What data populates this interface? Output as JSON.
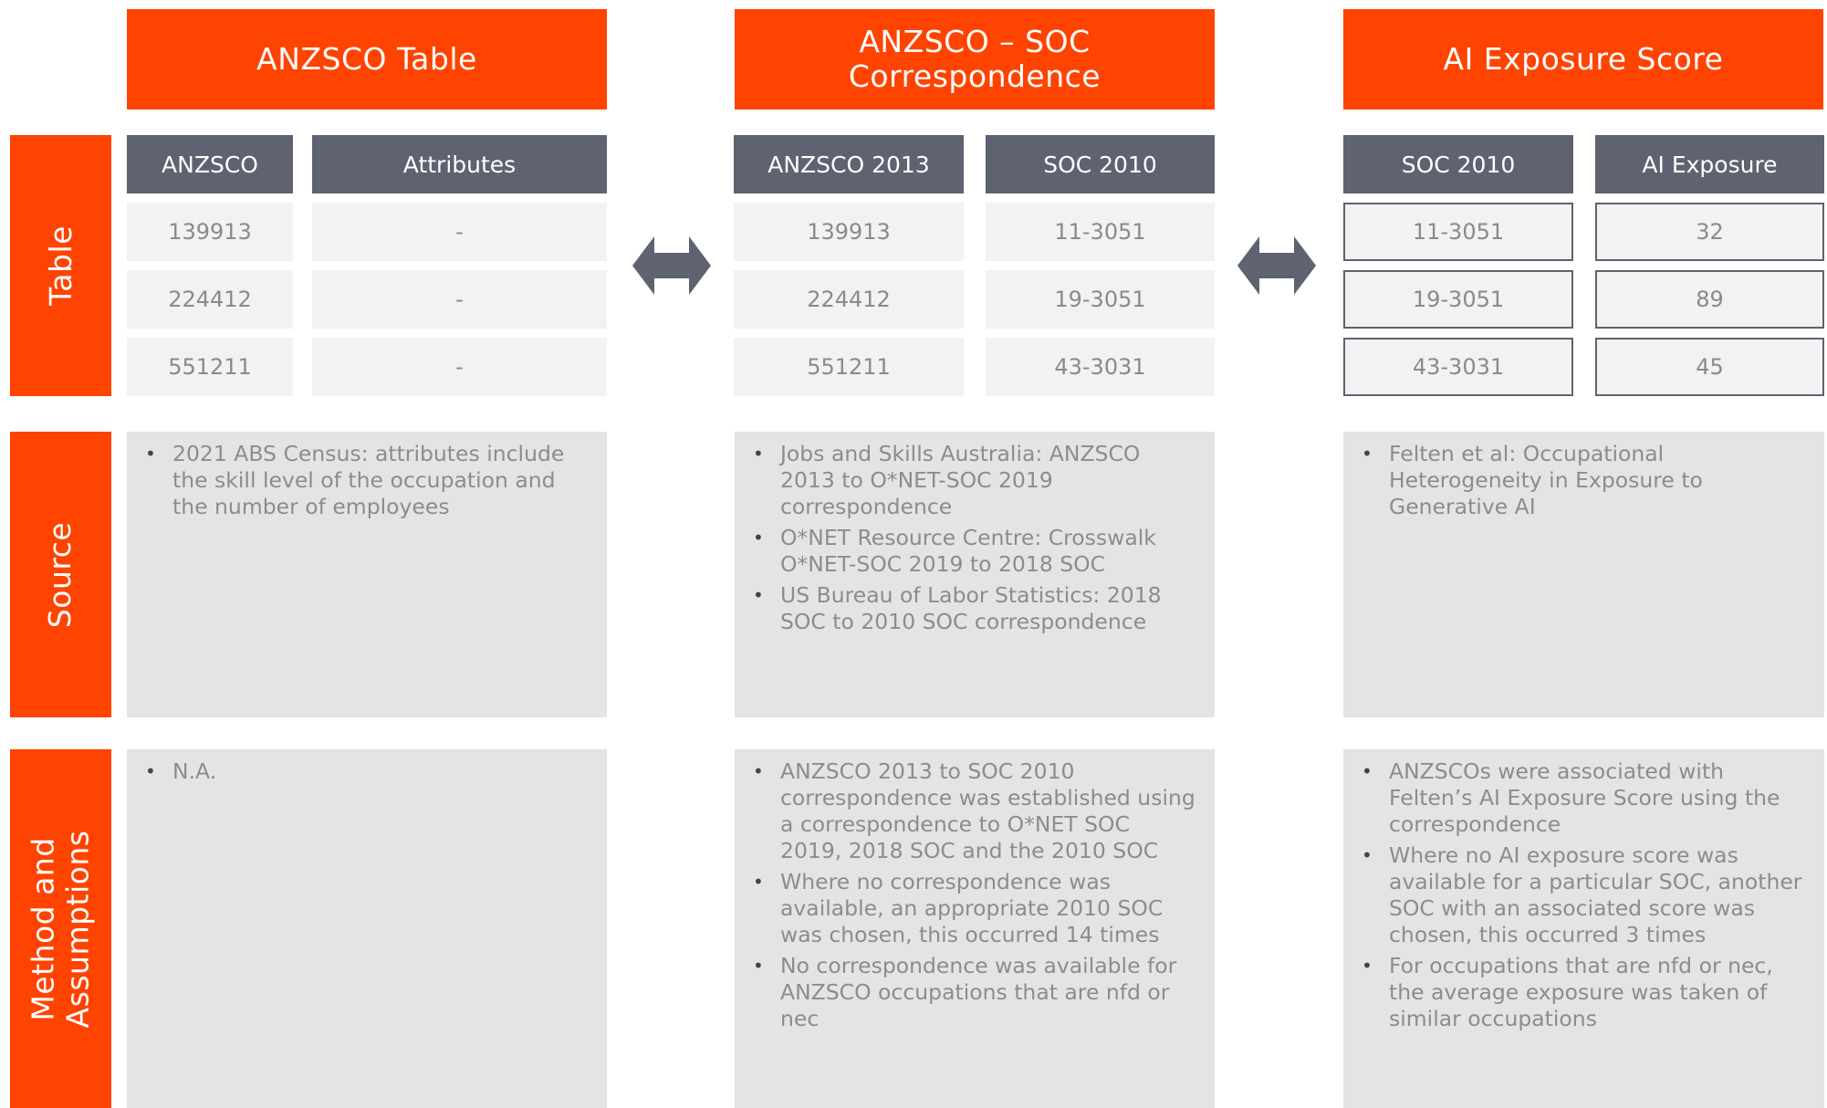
{
  "columns": [
    {
      "title": "ANZSCO Table"
    },
    {
      "title": "ANZSCO – SOC Correspondence"
    },
    {
      "title": "AI Exposure Score"
    }
  ],
  "row_labels": {
    "table": "Table",
    "source": "Source",
    "method": "Method and Assumptions"
  },
  "tables": {
    "anzsco": {
      "headers": [
        "ANZSCO",
        "Attributes"
      ],
      "rows": [
        [
          "139913",
          "-"
        ],
        [
          "224412",
          "-"
        ],
        [
          "551211",
          "-"
        ]
      ]
    },
    "correspondence": {
      "headers": [
        "ANZSCO 2013",
        "SOC 2010"
      ],
      "rows": [
        [
          "139913",
          "11-3051"
        ],
        [
          "224412",
          "19-3051"
        ],
        [
          "551211",
          "43-3031"
        ]
      ]
    },
    "exposure": {
      "headers": [
        "SOC 2010",
        "AI Exposure"
      ],
      "rows": [
        [
          "11-3051",
          "32"
        ],
        [
          "19-3051",
          "89"
        ],
        [
          "43-3031",
          "45"
        ]
      ]
    }
  },
  "sources": {
    "col1": [
      "2021 ABS Census: attributes include the skill level of the occupation and the number of employees"
    ],
    "col2": [
      "Jobs and Skills Australia: ANZSCO 2013 to O*NET-SOC 2019 correspondence",
      "O*NET Resource Centre: Crosswalk O*NET-SOC 2019 to 2018 SOC",
      "US Bureau of Labor Statistics: 2018 SOC to 2010 SOC correspondence"
    ],
    "col3": [
      "Felten et al: Occupational Heterogeneity in Exposure to Generative AI"
    ]
  },
  "methods": {
    "col1": [
      "N.A."
    ],
    "col2": [
      "ANZSCO 2013 to SOC 2010 correspondence was established using a correspondence to O*NET SOC 2019, 2018 SOC and the 2010 SOC",
      "Where no correspondence was available, an appropriate 2010 SOC was chosen, this occurred 14 times",
      "No correspondence was available for ANZSCO occupations that are nfd or nec"
    ],
    "col3": [
      "ANZSCOs were associated with Felten’s AI Exposure Score using the correspondence",
      "Where no AI exposure score was available for a particular SOC, another SOC with an associated score was chosen, this occurred 3 times",
      "For occupations that are nfd or nec, the average exposure was taken of similar occupations"
    ]
  },
  "colors": {
    "accent": "#ff4300",
    "header_dark": "#5f6270",
    "cell_bg": "#f2f2f2",
    "panel_bg": "#e4e4e4"
  },
  "icons": [
    "double-arrow-icon",
    "double-arrow-icon"
  ]
}
